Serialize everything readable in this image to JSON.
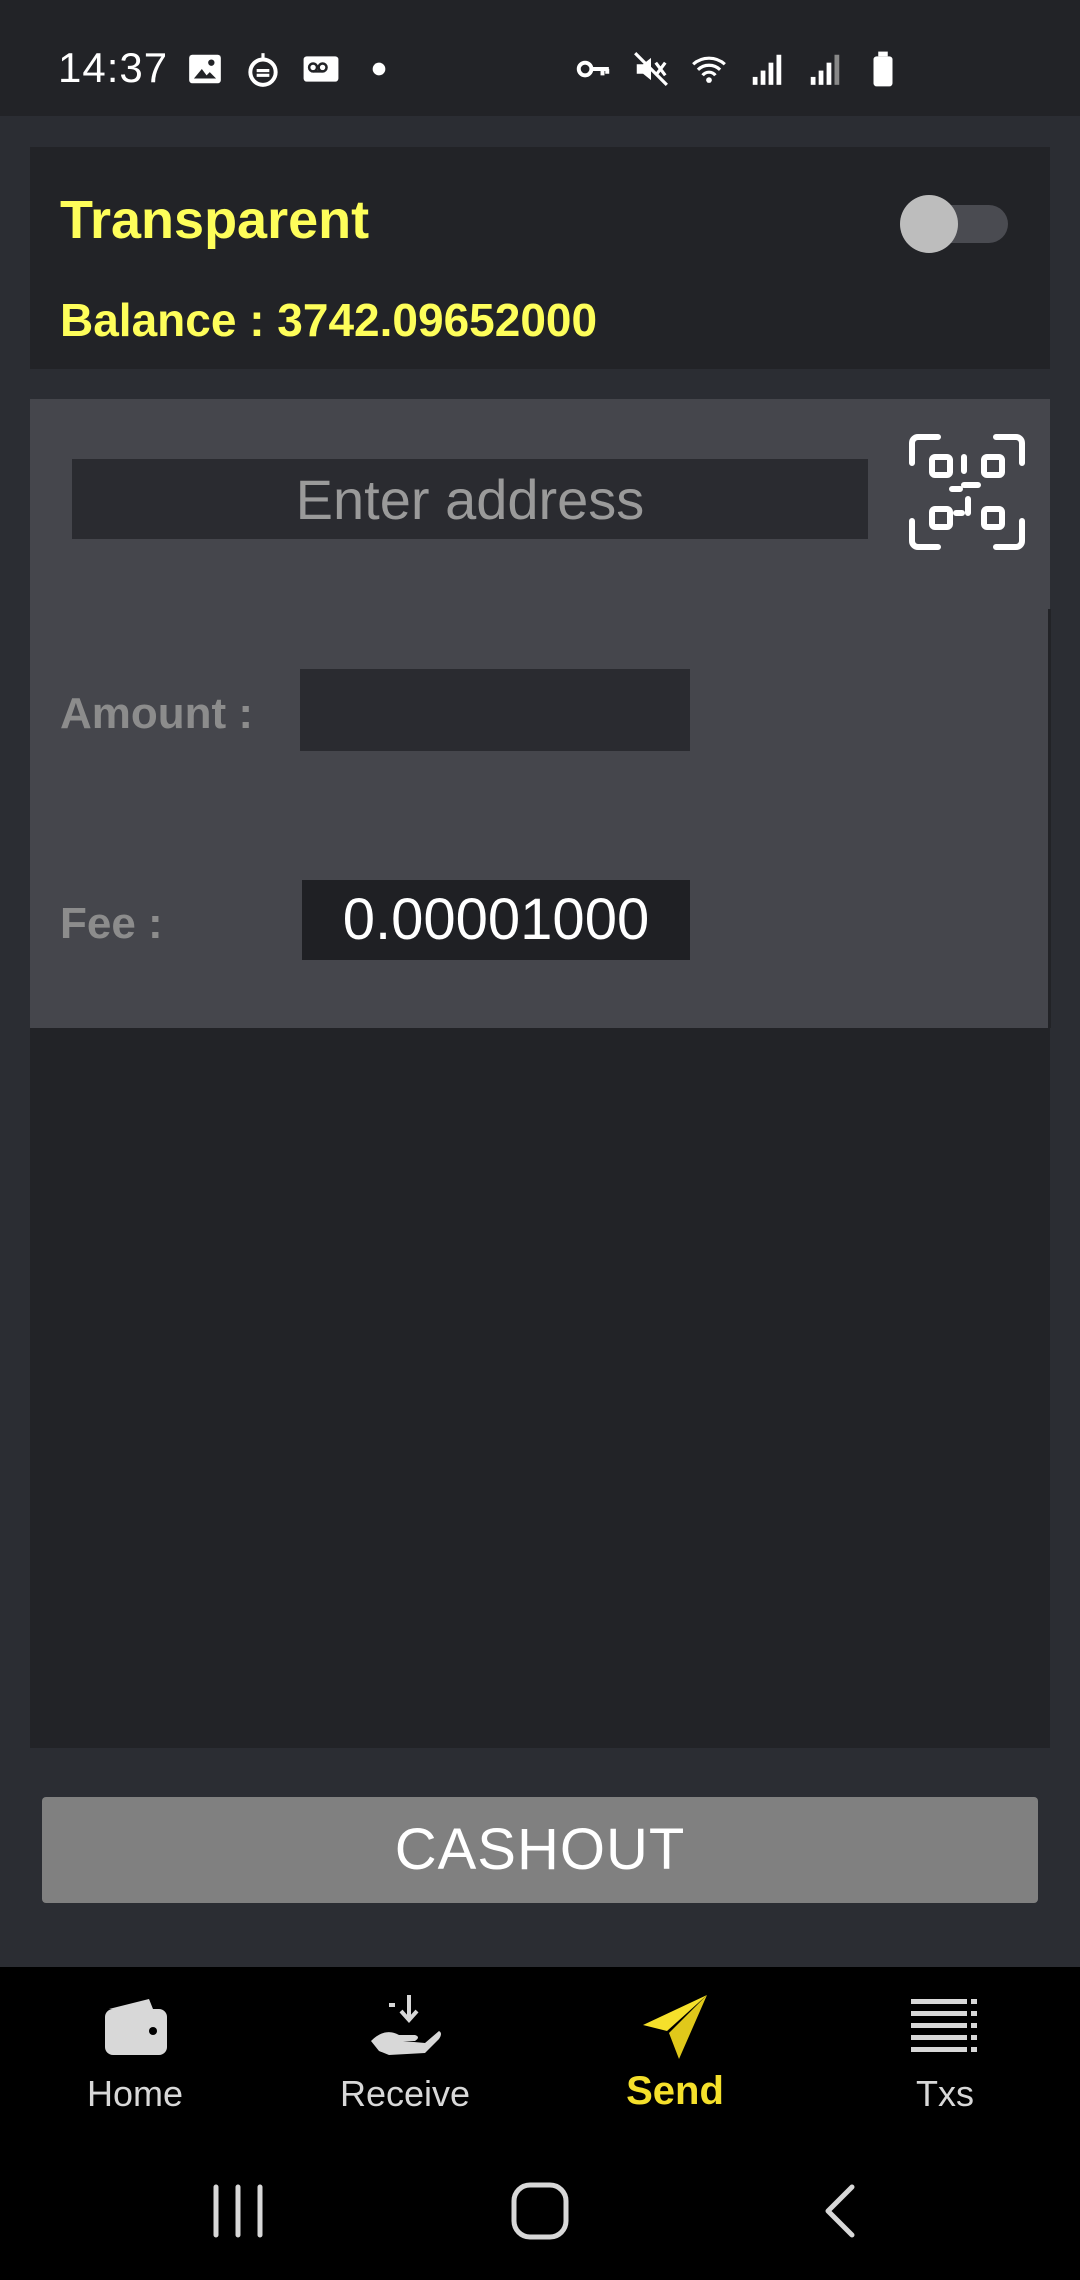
{
  "status_bar": {
    "time": "14:37",
    "left_icons": [
      "image-icon",
      "sync-app-icon",
      "voicemail-icon",
      "dot-icon"
    ],
    "right_icons": [
      "vpn-key-icon",
      "mute-icon",
      "wifi-icon",
      "signal-1-icon",
      "signal-2-icon",
      "battery-icon"
    ]
  },
  "header": {
    "title": "Transparent",
    "balance": "Balance : 3742.09652000",
    "toggle_on": false
  },
  "form": {
    "address_placeholder": "Enter address",
    "address_value": "",
    "amount_label": "Amount :",
    "amount_value": "",
    "fee_label": "Fee :",
    "fee_value": "0.00001000"
  },
  "actions": {
    "cashout_label": "CASHOUT"
  },
  "bottom_nav": {
    "items": [
      {
        "label": "Home",
        "icon": "wallet-icon",
        "active": false
      },
      {
        "label": "Receive",
        "icon": "receive-hand-icon",
        "active": false
      },
      {
        "label": "Send",
        "icon": "paper-plane-icon",
        "active": true
      },
      {
        "label": "Txs",
        "icon": "list-icon",
        "active": false
      }
    ]
  },
  "colors": {
    "accent_yellow": "#fefe5a",
    "active_nav": "#f5e02b",
    "card_dark": "#222327",
    "form_gray": "#45464c",
    "button_gray": "#808080"
  }
}
